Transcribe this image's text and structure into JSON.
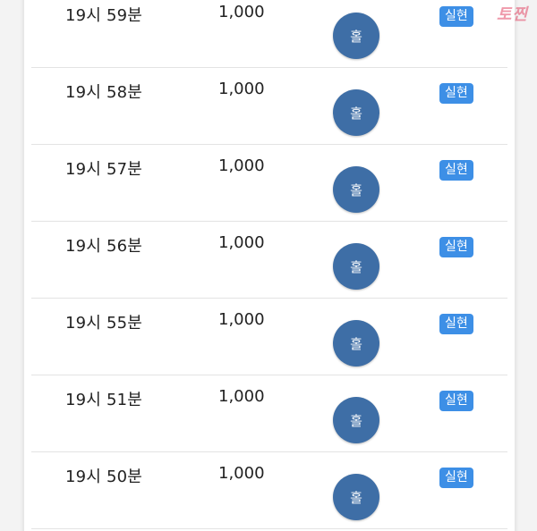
{
  "rows": [
    {
      "time": "19시 59분",
      "amount": "1,000",
      "pick": "홀",
      "status": "실현"
    },
    {
      "time": "19시 58분",
      "amount": "1,000",
      "pick": "홀",
      "status": "실현"
    },
    {
      "time": "19시 57분",
      "amount": "1,000",
      "pick": "홀",
      "status": "실현"
    },
    {
      "time": "19시 56분",
      "amount": "1,000",
      "pick": "홀",
      "status": "실현"
    },
    {
      "time": "19시 55분",
      "amount": "1,000",
      "pick": "홀",
      "status": "실현"
    },
    {
      "time": "19시 51분",
      "amount": "1,000",
      "pick": "홀",
      "status": "실현"
    },
    {
      "time": "19시 50분",
      "amount": "1,000",
      "pick": "홀",
      "status": "실현"
    }
  ],
  "watermark": "토찐",
  "colors": {
    "pick_circle": "#3e6ea6",
    "status_badge": "#3d8fe6"
  }
}
